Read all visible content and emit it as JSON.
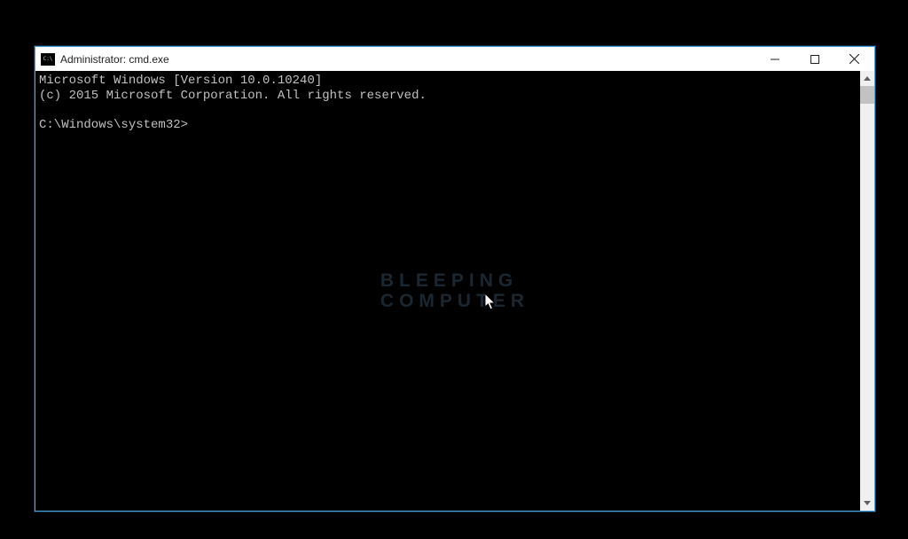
{
  "titlebar": {
    "text": "Administrator: cmd.exe"
  },
  "console": {
    "line1": "Microsoft Windows [Version 10.0.10240]",
    "line2": "(c) 2015 Microsoft Corporation. All rights reserved.",
    "blank": "",
    "prompt": "C:\\Windows\\system32>"
  },
  "watermark": {
    "line1": "BLEEPING",
    "line2": "COMPUTER"
  }
}
